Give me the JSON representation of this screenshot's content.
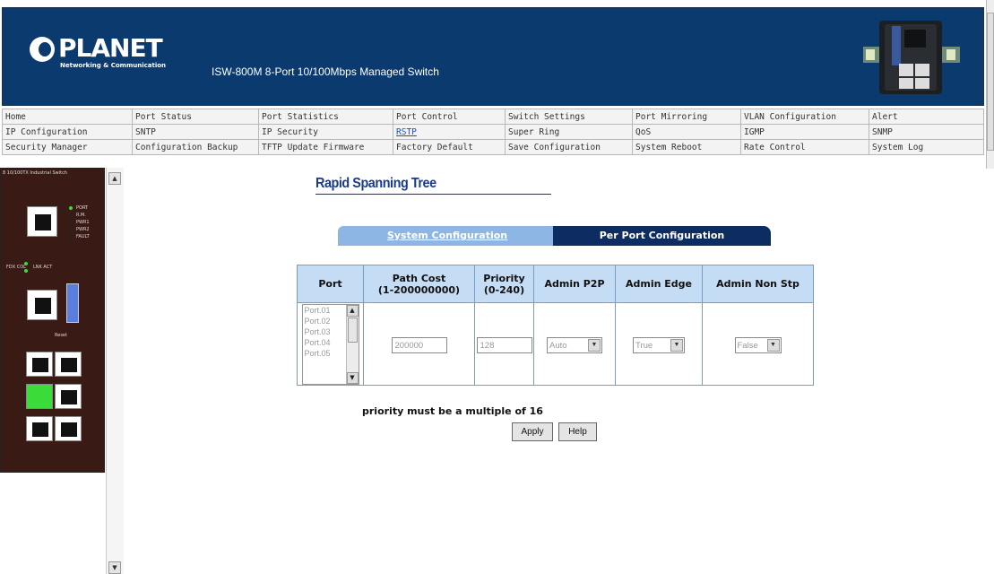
{
  "header": {
    "logo_text": "PLANET",
    "logo_sub": "Networking & Communication",
    "product_title": "ISW-800M 8-Port 10/100Mbps Managed Switch"
  },
  "menu": {
    "rows": [
      [
        "Home",
        "Port Status",
        "Port Statistics",
        "Port Control",
        "Switch Settings",
        "Port Mirroring",
        "VLAN Configuration",
        "Alert"
      ],
      [
        "IP Configuration",
        "SNTP",
        "IP Security",
        "RSTP",
        "Super Ring",
        "QoS",
        "IGMP",
        "SNMP"
      ],
      [
        "Security Manager",
        "Configuration Backup",
        "TFTP Update Firmware",
        "Factory Default",
        "Save Configuration",
        "System Reboot",
        "Rate Control",
        "System Log"
      ]
    ],
    "active": "RSTP"
  },
  "device_panel": {
    "title": "8 10/100TX Industrial Switch",
    "labels": {
      "port": "PORT",
      "rm": "R.M.",
      "pwr1": "PWR1",
      "pwr2": "PWR2",
      "fault": "FAULT",
      "fdx_col": "FDX COL",
      "lnk_act": "LNK ACT",
      "reset": "Reset"
    }
  },
  "page": {
    "title": "Rapid Spanning Tree",
    "tabs": {
      "system": "System Configuration",
      "per_port": "Per Port Configuration"
    },
    "table": {
      "headers": {
        "port": "Port",
        "path_cost": "Path Cost",
        "path_cost_range": "(1-200000000)",
        "priority": "Priority",
        "priority_range": "(0-240)",
        "admin_p2p": "Admin P2P",
        "admin_edge": "Admin Edge",
        "admin_non_stp": "Admin Non Stp"
      },
      "port_options": [
        "Port.01",
        "Port.02",
        "Port.03",
        "Port.04",
        "Port.05"
      ],
      "path_cost_value": "200000",
      "priority_value": "128",
      "admin_p2p_value": "Auto",
      "admin_edge_value": "True",
      "admin_non_stp_value": "False"
    },
    "note": "priority must be a multiple of 16",
    "buttons": {
      "apply": "Apply",
      "help": "Help"
    }
  }
}
